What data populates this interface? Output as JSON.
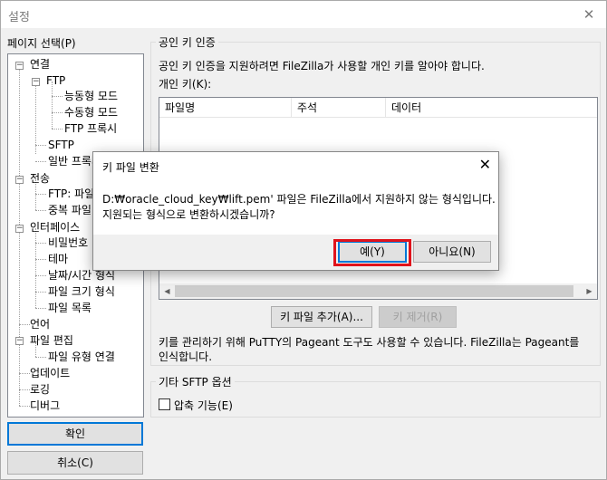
{
  "window": {
    "title": "설정",
    "close_glyph": "✕"
  },
  "sidebar": {
    "label": "페이지 선택(P)",
    "tree": [
      {
        "label": "연결",
        "toggle": "−"
      },
      {
        "label": "FTP",
        "toggle": "−"
      },
      {
        "label": "능동형 모드"
      },
      {
        "label": "수동형 모드"
      },
      {
        "label": "FTP 프록시"
      },
      {
        "label": "SFTP"
      },
      {
        "label": "일반 프록시"
      },
      {
        "label": "전송",
        "toggle": "−"
      },
      {
        "label": "FTP: 파일"
      },
      {
        "label": "중복 파일"
      },
      {
        "label": "인터페이스",
        "toggle": "−"
      },
      {
        "label": "비밀번호"
      },
      {
        "label": "테마"
      },
      {
        "label": "날짜/시간 형식"
      },
      {
        "label": "파일 크기 형식"
      },
      {
        "label": "파일 목록"
      },
      {
        "label": "언어"
      },
      {
        "label": "파일 편집",
        "toggle": "−"
      },
      {
        "label": "파일 유형 연결"
      },
      {
        "label": "업데이트"
      },
      {
        "label": "로깅"
      },
      {
        "label": "디버그"
      }
    ],
    "ok_label": "확인",
    "cancel_label": "취소(C)"
  },
  "pubkey": {
    "group_title": "공인 키 인증",
    "description": "공인 키 인증을 지원하려면 FileZilla가 사용할 개인 키를 알아야 합니다.",
    "private_key_label": "개인 키(K):",
    "columns": [
      "파일명",
      "주석",
      "데이터"
    ],
    "add_key_label": "키 파일 추가(A)...",
    "remove_key_label": "키 제거(R)",
    "pageant_note_line1": "키를 관리하기 위해 PuTTY의 Pageant 도구도 사용할 수 있습니다. FileZilla는 Pageant를",
    "pageant_note_line2": "인식합니다."
  },
  "other_sftp": {
    "group_title": "기타 SFTP 옵션",
    "compression_label": "압축 기능(E)",
    "compression_checked": false
  },
  "dialog": {
    "title": "키 파일 변환",
    "close_glyph": "✕",
    "message_line1": "D:₩oracle_cloud_key₩lift.pem' 파일은 FileZilla에서 지원하지 않는 형식입니다.",
    "message_line2": "지원되는 형식으로 변환하시겠습니까?",
    "yes_label": "예(Y)",
    "no_label": "아니요(N)"
  },
  "colors": {
    "accent": "#0078d7",
    "highlight": "#e0121b"
  }
}
